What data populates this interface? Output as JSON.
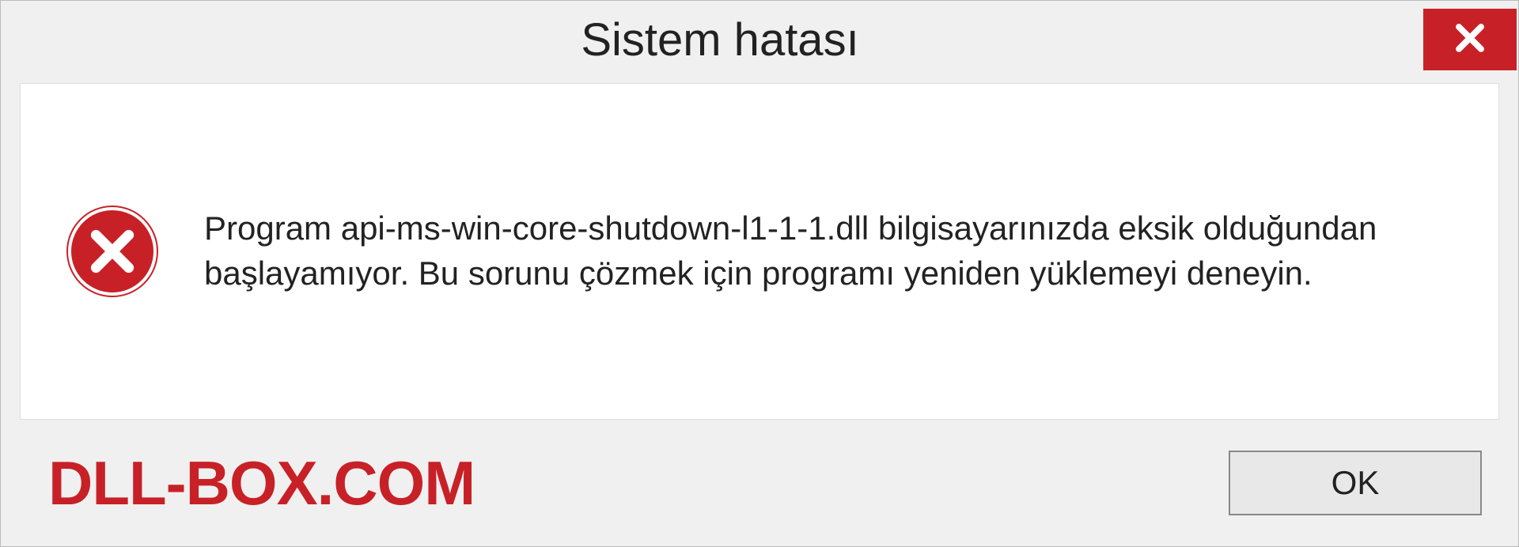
{
  "dialog": {
    "title": "Sistem hatası",
    "message": "Program api-ms-win-core-shutdown-l1-1-1.dll bilgisayarınızda eksik olduğundan başlayamıyor. Bu sorunu çözmek için programı yeniden yüklemeyi deneyin.",
    "ok_label": "OK"
  },
  "watermark": "DLL-BOX.COM"
}
